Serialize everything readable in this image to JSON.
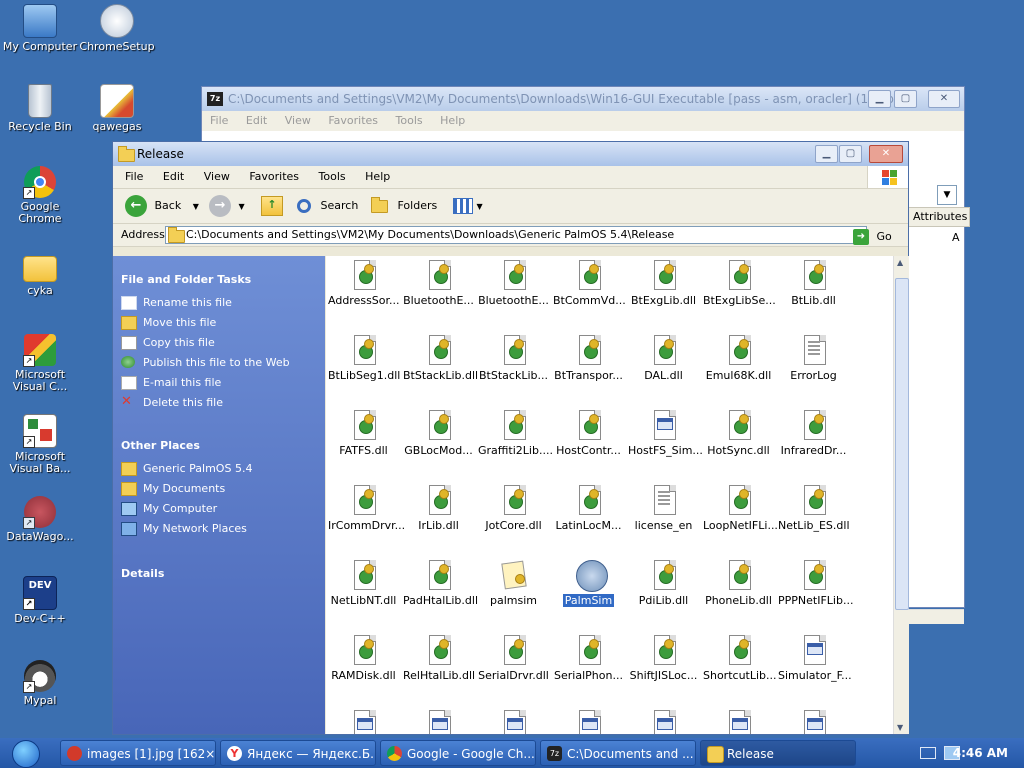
{
  "desktop": {
    "icons": [
      {
        "label": "My Computer"
      },
      {
        "label": "ChromeSetup"
      },
      {
        "label": "Recycle Bin"
      },
      {
        "label": "qawegas"
      },
      {
        "label": "Google Chrome"
      },
      {
        "label": "cyka"
      },
      {
        "label": "Microsoft Visual C..."
      },
      {
        "label": "Microsoft Visual Ba..."
      },
      {
        "label": "DataWago..."
      },
      {
        "label": "Dev-C++"
      },
      {
        "label": "Mypal"
      }
    ]
  },
  "back_window": {
    "title": "C:\\Documents and Settings\\VM2\\My Documents\\Downloads\\Win16-GUI Executable [pass - asm, oracler] (1).zip\\",
    "menu": [
      "File",
      "Edit",
      "View",
      "Favorites",
      "Tools",
      "Help"
    ],
    "column_header": "Attributes",
    "cell": "A"
  },
  "window": {
    "title": "Release",
    "menu": [
      "File",
      "Edit",
      "View",
      "Favorites",
      "Tools",
      "Help"
    ],
    "toolbar": {
      "back": "Back",
      "search": "Search",
      "folders": "Folders"
    },
    "address_label": "Address",
    "address": "C:\\Documents and Settings\\VM2\\My Documents\\Downloads\\Generic PalmOS 5.4\\Release",
    "go": "Go"
  },
  "tasks": {
    "file_tasks_title": "File and Folder Tasks",
    "file_tasks": [
      {
        "label": "Rename this file"
      },
      {
        "label": "Move this file"
      },
      {
        "label": "Copy this file"
      },
      {
        "label": "Publish this file to the Web"
      },
      {
        "label": "E-mail this file"
      },
      {
        "label": "Delete this file"
      }
    ],
    "other_places_title": "Other Places",
    "other_places": [
      {
        "label": "Generic PalmOS 5.4"
      },
      {
        "label": "My Documents"
      },
      {
        "label": "My Computer"
      },
      {
        "label": "My Network Places"
      }
    ],
    "details_title": "Details"
  },
  "files": [
    {
      "name": "AddressSor...",
      "kind": "dll"
    },
    {
      "name": "BluetoothE...",
      "kind": "dll"
    },
    {
      "name": "BluetoothE...",
      "kind": "dll"
    },
    {
      "name": "BtCommVd...",
      "kind": "dll"
    },
    {
      "name": "BtExgLib.dll",
      "kind": "dll"
    },
    {
      "name": "BtExgLibSe...",
      "kind": "dll"
    },
    {
      "name": "BtLib.dll",
      "kind": "dll"
    },
    {
      "name": "BtLibSeg1.dll",
      "kind": "dll"
    },
    {
      "name": "BtStackLib.dll",
      "kind": "dll"
    },
    {
      "name": "BtStackLib...",
      "kind": "dll"
    },
    {
      "name": "BtTranspor...",
      "kind": "dll"
    },
    {
      "name": "DAL.dll",
      "kind": "dll"
    },
    {
      "name": "Emul68K.dll",
      "kind": "dll"
    },
    {
      "name": "ErrorLog",
      "kind": "txt"
    },
    {
      "name": "FATFS.dll",
      "kind": "dll"
    },
    {
      "name": "GBLocMod...",
      "kind": "dll"
    },
    {
      "name": "Graffiti2Lib....",
      "kind": "dll"
    },
    {
      "name": "HostContr...",
      "kind": "dll"
    },
    {
      "name": "HostFS_Sim...",
      "kind": "exe"
    },
    {
      "name": "HotSync.dll",
      "kind": "dll"
    },
    {
      "name": "InfraredDr...",
      "kind": "dll"
    },
    {
      "name": "IrCommDrvr...",
      "kind": "dll"
    },
    {
      "name": "IrLib.dll",
      "kind": "dll"
    },
    {
      "name": "JotCore.dll",
      "kind": "dll"
    },
    {
      "name": "LatinLocM...",
      "kind": "dll"
    },
    {
      "name": "license_en",
      "kind": "txt"
    },
    {
      "name": "LoopNetIFLi...",
      "kind": "dll"
    },
    {
      "name": "NetLib_ES.dll",
      "kind": "dll"
    },
    {
      "name": "NetLibNT.dll",
      "kind": "dll"
    },
    {
      "name": "PadHtalLib.dll",
      "kind": "dll"
    },
    {
      "name": "palmsim",
      "kind": "cfg"
    },
    {
      "name": "PalmSim",
      "kind": "palm",
      "selected": true
    },
    {
      "name": "PdiLib.dll",
      "kind": "dll"
    },
    {
      "name": "PhoneLib.dll",
      "kind": "dll"
    },
    {
      "name": "PPPNetIFLib...",
      "kind": "dll"
    },
    {
      "name": "RAMDisk.dll",
      "kind": "dll"
    },
    {
      "name": "RelHtalLib.dll",
      "kind": "dll"
    },
    {
      "name": "SerialDrvr.dll",
      "kind": "dll"
    },
    {
      "name": "SerialPhon...",
      "kind": "dll"
    },
    {
      "name": "ShiftJISLoc...",
      "kind": "dll"
    },
    {
      "name": "ShortcutLib...",
      "kind": "dll"
    },
    {
      "name": "Simulator_F...",
      "kind": "exe"
    },
    {
      "name": "",
      "kind": "exe"
    },
    {
      "name": "",
      "kind": "exe"
    },
    {
      "name": "",
      "kind": "exe"
    },
    {
      "name": "",
      "kind": "exe"
    },
    {
      "name": "",
      "kind": "exe"
    },
    {
      "name": "",
      "kind": "exe"
    },
    {
      "name": "",
      "kind": "exe"
    }
  ],
  "taskbar": {
    "tasks": [
      {
        "label": "images [1].jpg [162×...",
        "color": "#d23a2a"
      },
      {
        "label": "Яндекс — Яндекс.Б...",
        "color": "#e33"
      },
      {
        "label": "Google - Google Ch...",
        "color": "#3b8ede"
      },
      {
        "label": "C:\\Documents and ...",
        "color": "#222"
      },
      {
        "label": "Release",
        "color": "#f3cf55",
        "active": true
      }
    ],
    "clock": "4:46 AM"
  },
  "colors": {
    "desktop": "#3b6fb0",
    "selection": "#316ac5",
    "taskpane": "#5675c6"
  }
}
